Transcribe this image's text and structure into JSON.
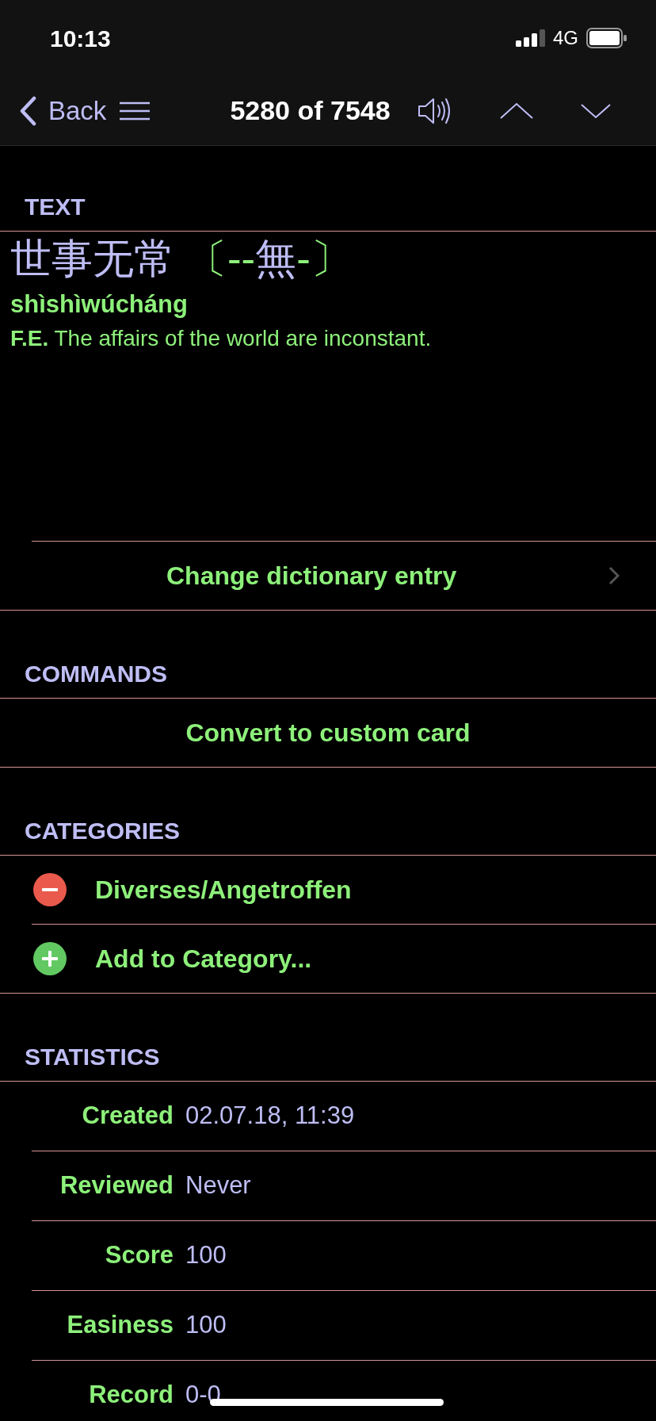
{
  "status_bar": {
    "time": "10:13",
    "network": "4G"
  },
  "nav_bar": {
    "back": "Back",
    "title": "5280 of 7548"
  },
  "text_section": {
    "header": "TEXT",
    "headword": "世事无常",
    "variant": [
      {
        "kind": "mark",
        "text": "〔--"
      },
      {
        "kind": "char",
        "text": "無"
      },
      {
        "kind": "mark",
        "text": "-〕"
      }
    ],
    "pinyin": "shìshìwúcháng",
    "definition": "**F.E.** The affairs of the world are inconstant.",
    "action": "Change dictionary entry"
  },
  "commands": {
    "header": "COMMANDS",
    "items": [
      "Convert to custom card"
    ]
  },
  "categories": {
    "header": "CATEGORIES",
    "items": [
      {
        "kind": "remove",
        "label": "Diverses/Angetroffen"
      },
      {
        "kind": "add",
        "label": "Add to Category..."
      }
    ]
  },
  "statistics": {
    "header": "STATISTICS",
    "rows": [
      {
        "label": "Created",
        "value": "02.07.18, 11:39"
      },
      {
        "label": "Reviewed",
        "value": "Never"
      },
      {
        "label": "Score",
        "value": "100"
      },
      {
        "label": "Easiness",
        "value": "100"
      },
      {
        "label": "Record",
        "value": "0-0"
      }
    ]
  }
}
